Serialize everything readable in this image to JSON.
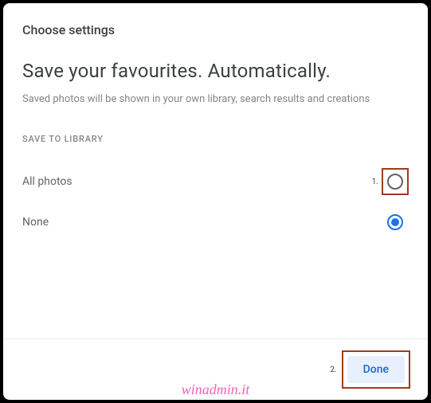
{
  "dialog": {
    "title": "Choose settings",
    "headline": "Save your favourites. Automatically.",
    "subtext": "Saved photos will be shown in your own library, search results and creations",
    "section_label": "SAVE TO LIBRARY",
    "options": [
      {
        "label": "All photos",
        "selected": false
      },
      {
        "label": "None",
        "selected": true
      }
    ],
    "footer": {
      "done": "Done"
    }
  },
  "annotations": {
    "a1": "1.",
    "a2": "2."
  },
  "watermark": "winadmin.it"
}
